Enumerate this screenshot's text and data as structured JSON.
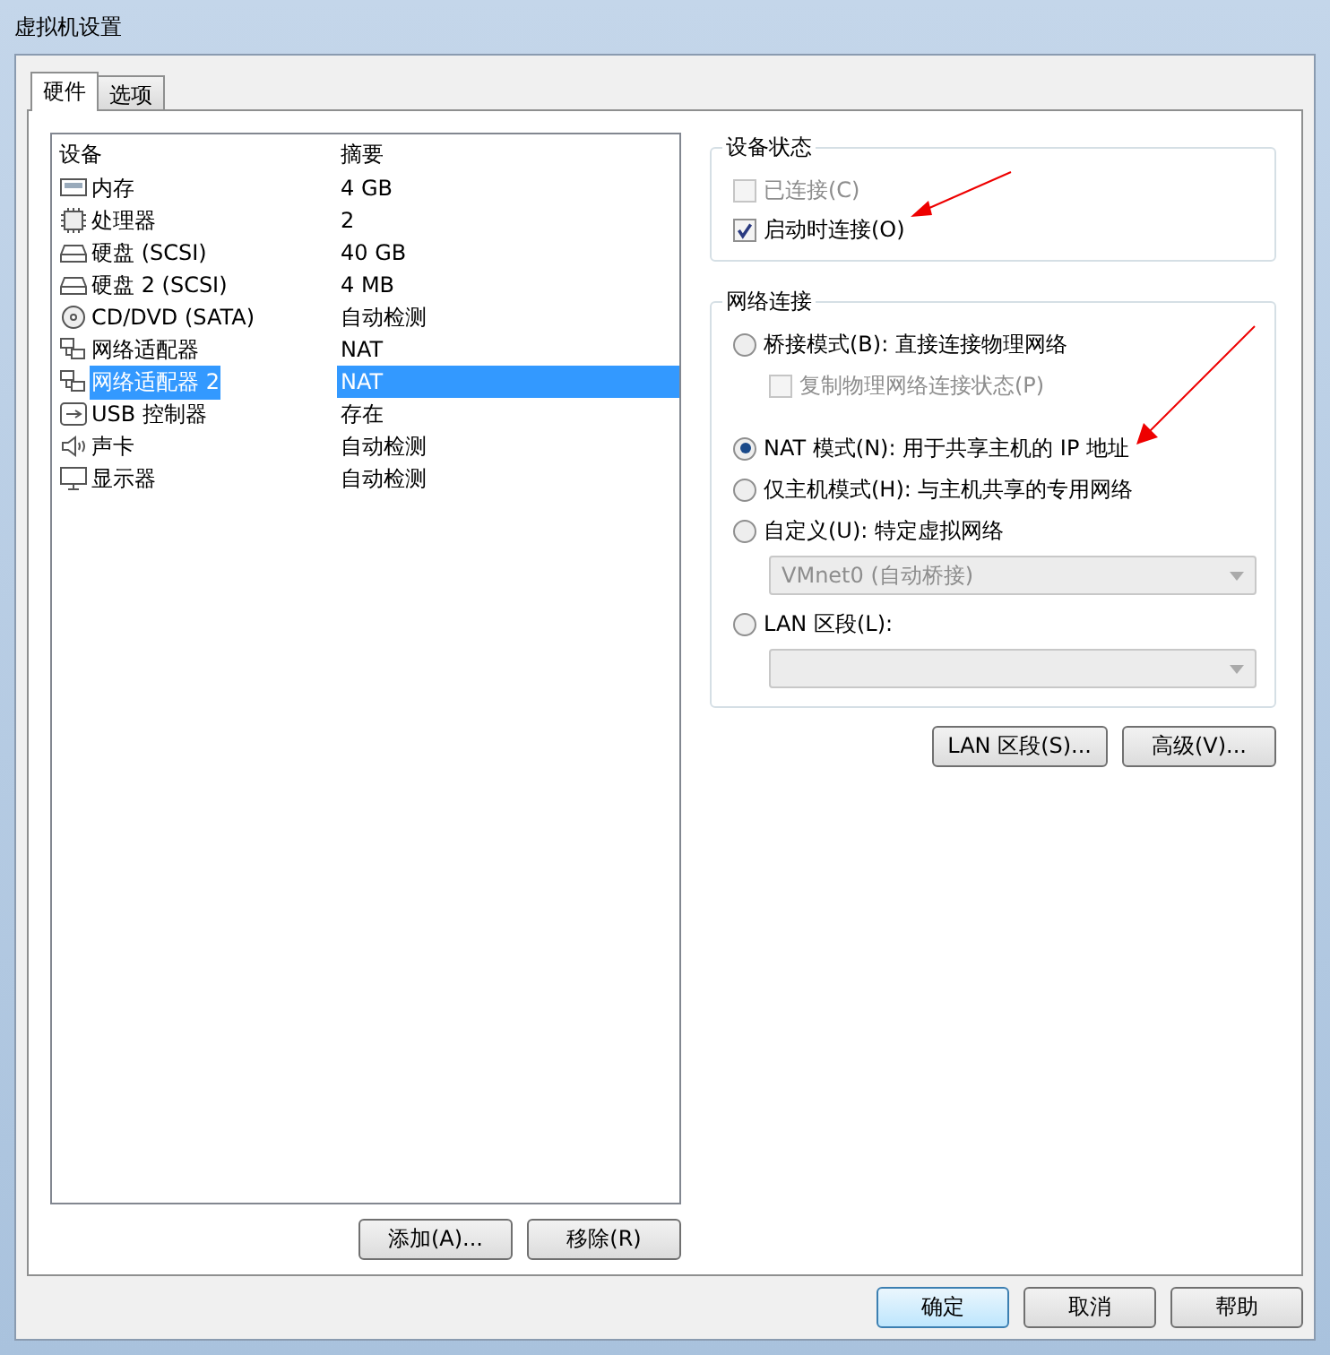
{
  "window": {
    "title": "虚拟机设置"
  },
  "tabs": [
    {
      "label": "硬件",
      "selected": true
    },
    {
      "label": "选项",
      "selected": false
    }
  ],
  "device_table": {
    "columns": [
      "设备",
      "摘要"
    ],
    "rows": [
      {
        "kind": "memory",
        "device": "内存",
        "summary": "4 GB",
        "selected": false
      },
      {
        "kind": "cpu",
        "device": "处理器",
        "summary": "2",
        "selected": false
      },
      {
        "kind": "disk",
        "device": "硬盘 (SCSI)",
        "summary": "40 GB",
        "selected": false
      },
      {
        "kind": "disk",
        "device": "硬盘 2 (SCSI)",
        "summary": "4 MB",
        "selected": false
      },
      {
        "kind": "cdrom",
        "device": "CD/DVD (SATA)",
        "summary": "自动检测",
        "selected": false
      },
      {
        "kind": "network",
        "device": "网络适配器",
        "summary": "NAT",
        "selected": false
      },
      {
        "kind": "network",
        "device": "网络适配器 2",
        "summary": "NAT",
        "selected": true
      },
      {
        "kind": "usb",
        "device": "USB 控制器",
        "summary": "存在",
        "selected": false
      },
      {
        "kind": "sound",
        "device": "声卡",
        "summary": "自动检测",
        "selected": false
      },
      {
        "kind": "display",
        "device": "显示器",
        "summary": "自动检测",
        "selected": false
      }
    ]
  },
  "list_buttons": [
    "添加(A)...",
    "移除(R)"
  ],
  "device_status": {
    "title": "设备状态",
    "items": [
      {
        "label": "已连接(C)",
        "checked": false,
        "disabled": true
      },
      {
        "label": "启动时连接(O)",
        "checked": true,
        "disabled": false
      }
    ]
  },
  "network_connection": {
    "title": "网络连接",
    "items": [
      {
        "kind": "radio",
        "label": "桥接模式(B): 直接连接物理网络",
        "selected": false
      },
      {
        "kind": "checkbox",
        "label": "复制物理网络连接状态(P)",
        "checked": false,
        "disabled": true
      },
      {
        "kind": "radio",
        "label": "NAT 模式(N): 用于共享主机的 IP 地址",
        "selected": true
      },
      {
        "kind": "radio",
        "label": "仅主机模式(H): 与主机共享的专用网络",
        "selected": false
      },
      {
        "kind": "radio",
        "label": "自定义(U): 特定虚拟网络",
        "selected": false
      },
      {
        "kind": "dropdown",
        "value": "VMnet0 (自动桥接)",
        "disabled": true
      },
      {
        "kind": "radio",
        "label": "LAN 区段(L):",
        "selected": false
      },
      {
        "kind": "dropdown",
        "disabled": true
      }
    ]
  },
  "network_buttons": [
    "LAN 区段(S)...",
    "高级(V)..."
  ],
  "dialog_buttons": [
    {
      "label": "确定",
      "default": true
    },
    {
      "label": "取消",
      "default": false
    },
    {
      "label": "帮助",
      "default": false
    }
  ]
}
